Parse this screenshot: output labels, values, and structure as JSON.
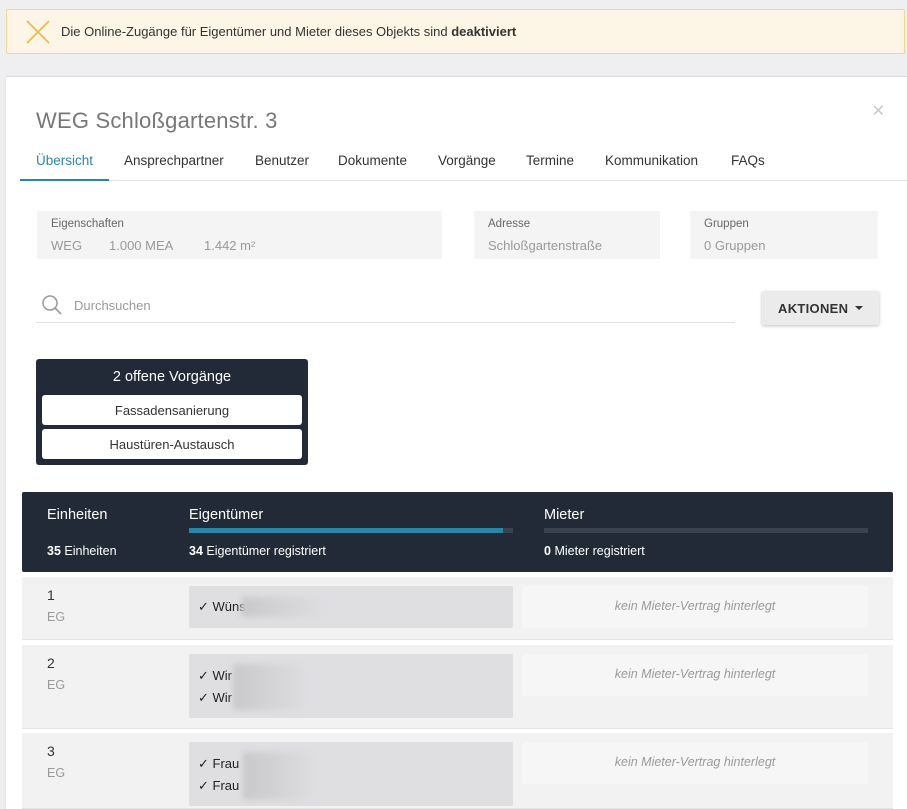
{
  "banner": {
    "message_prefix": "Die Online-Zugänge für Eigentümer und Mieter dieses Objekts sind",
    "message_emphasis": "deaktiviert",
    "icon": "close-icon",
    "accent_color": "#f0b54a"
  },
  "header": {
    "title": "WEG Schloßgartenstr. 3"
  },
  "tabs": [
    {
      "label": "Übersicht",
      "active": true
    },
    {
      "label": "Ansprechpartner"
    },
    {
      "label": "Benutzer"
    },
    {
      "label": "Dokumente"
    },
    {
      "label": "Vorgänge"
    },
    {
      "label": "Termine"
    },
    {
      "label": "Kommunikation"
    },
    {
      "label": "FAQs"
    }
  ],
  "properties": {
    "label": "Eigenschaften",
    "type": "WEG",
    "mea": "1.000 MEA",
    "area": "1.442 m²"
  },
  "address": {
    "label": "Adresse",
    "value": "Schloßgartenstraße"
  },
  "groups": {
    "label": "Gruppen",
    "value": "0 Gruppen"
  },
  "search": {
    "placeholder": "Durchsuchen"
  },
  "actions": {
    "label": "AKTIONEN"
  },
  "open_processes": {
    "title": "2 offene Vorgänge",
    "items": [
      "Fassadensanierung",
      "Haustüren-Austausch"
    ]
  },
  "units_header": {
    "units_label": "Einheiten",
    "units_count": "35",
    "units_count_suffix": "Einheiten",
    "owners_label": "Eigentümer",
    "owners_count": "34",
    "owners_count_suffix": "Eigentümer registriert",
    "owners_progress": 0.97,
    "tenants_label": "Mieter",
    "tenants_count": "0",
    "tenants_count_suffix": "Mieter registriert",
    "tenants_progress": 0
  },
  "units": [
    {
      "number": "1",
      "floor": "EG",
      "owners": [
        "✓ Wüns"
      ],
      "tenant": "kein Mieter-Vertrag hinterlegt"
    },
    {
      "number": "2",
      "floor": "EG",
      "owners": [
        "✓ Wir",
        "✓ Wir"
      ],
      "tenant": "kein Mieter-Vertrag hinterlegt"
    },
    {
      "number": "3",
      "floor": "EG",
      "owners": [
        "✓ Frau",
        "✓ Frau"
      ],
      "tenant": "kein Mieter-Vertrag hinterlegt"
    }
  ],
  "colors": {
    "accent": "#2a86a8",
    "dark_panel": "#222a38"
  }
}
